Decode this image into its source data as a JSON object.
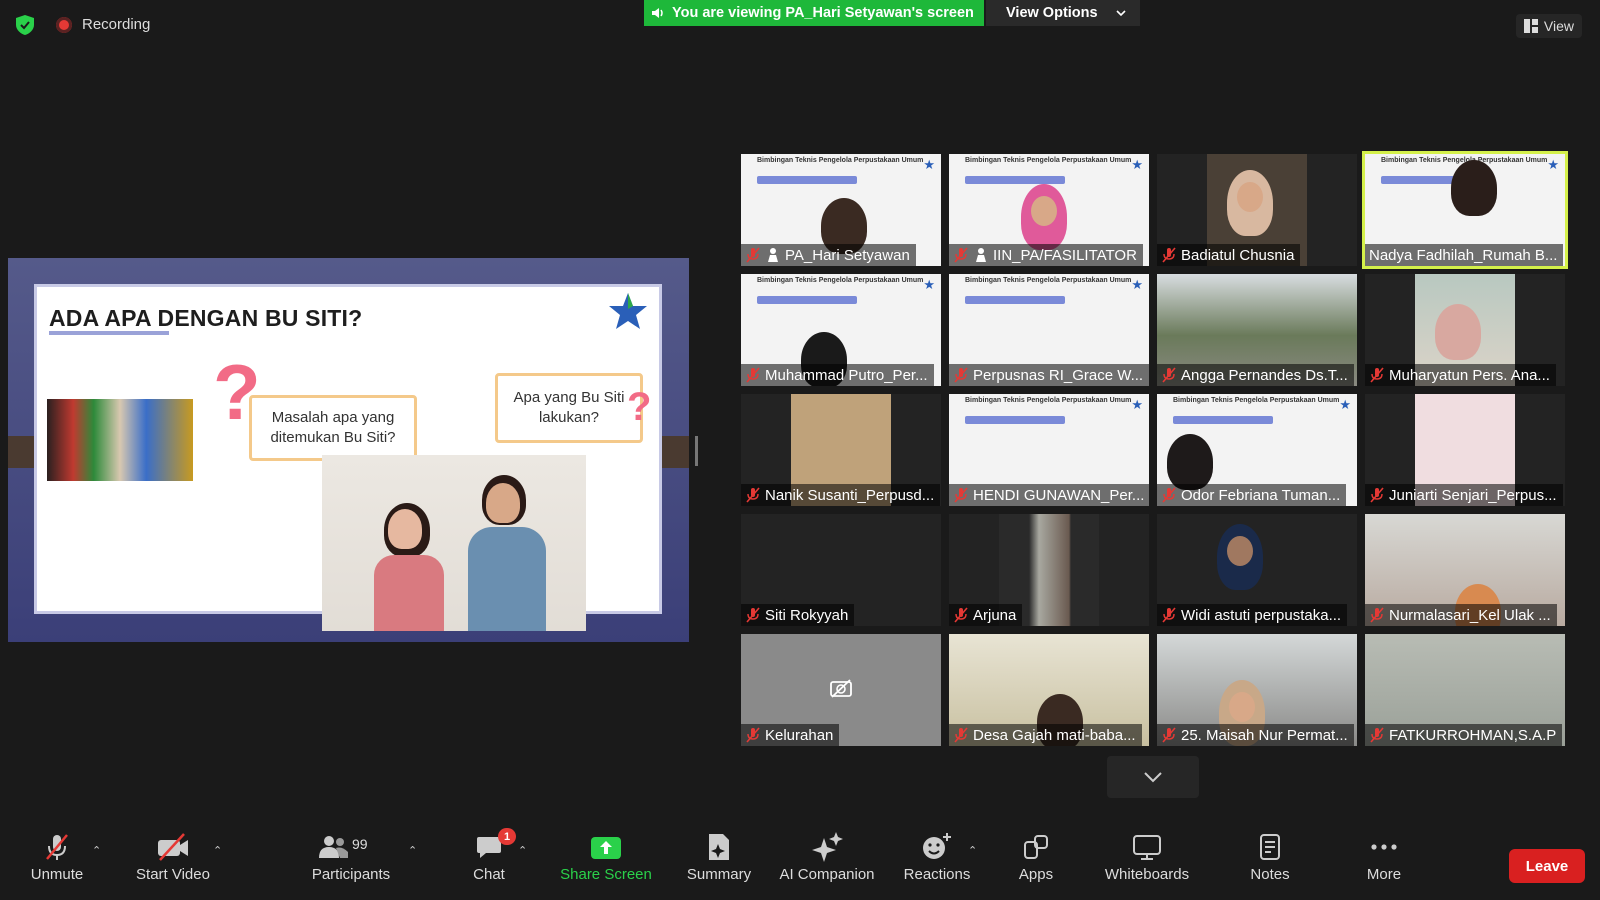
{
  "topbar": {
    "recording_label": "Recording",
    "viewing_banner": "You are viewing PA_Hari Setyawan's screen",
    "view_options_label": "View Options",
    "view_label": "View"
  },
  "shared_slide": {
    "title": "ADA APA DENGAN BU SITI?",
    "bubble_left": "Masalah apa yang ditemukan Bu Siti?",
    "bubble_right": "Apa yang Bu Siti lakukan?"
  },
  "gallery": {
    "participants": [
      {
        "name": "PA_Hari Setyawan",
        "muted": true,
        "host": true
      },
      {
        "name": "IIN_PA/FASILITATOR",
        "muted": true,
        "host": true
      },
      {
        "name": "Badiatul Chusnia",
        "muted": true
      },
      {
        "name": "Nadya Fadhilah_Rumah B...",
        "muted": false,
        "active_speaker": true
      },
      {
        "name": "Muhammad Putro_Per...",
        "muted": true
      },
      {
        "name": "Perpusnas RI_Grace W...",
        "muted": true
      },
      {
        "name": "Angga Pernandes Ds.T...",
        "muted": true
      },
      {
        "name": "Muharyatun Pers. Ana...",
        "muted": true
      },
      {
        "name": "Nanik Susanti_Perpusd...",
        "muted": true
      },
      {
        "name": "HENDI GUNAWAN_Per...",
        "muted": true
      },
      {
        "name": "Odor Febriana Tuman...",
        "muted": true
      },
      {
        "name": "Juniarti Senjari_Perpus...",
        "muted": true
      },
      {
        "name": "Siti Rokyyah",
        "muted": true
      },
      {
        "name": "Arjuna",
        "muted": true
      },
      {
        "name": "Widi astuti perpustaka...",
        "muted": true
      },
      {
        "name": "Nurmalasari_Kel Ulak ...",
        "muted": true
      },
      {
        "name": "Kelurahan",
        "muted": true
      },
      {
        "name": "Desa Gajah mati-baba...",
        "muted": true
      },
      {
        "name": "25. Maisah Nur Permat...",
        "muted": true
      },
      {
        "name": "FATKURROHMAN,S.A.P",
        "muted": true
      }
    ],
    "slide_thumb_title": "Bimbingan Teknis Pengelola Perpustakaan Umum"
  },
  "toolbar": {
    "unmute": "Unmute",
    "start_video": "Start Video",
    "participants": "Participants",
    "participants_count": "99",
    "chat": "Chat",
    "chat_badge": "1",
    "share_screen": "Share Screen",
    "summary": "Summary",
    "ai_companion": "AI Companion",
    "reactions": "Reactions",
    "apps": "Apps",
    "whiteboards": "Whiteboards",
    "notes": "Notes",
    "more": "More",
    "leave": "Leave"
  },
  "colors": {
    "accent_green": "#1eb83a",
    "leave_red": "#d92020",
    "active_speaker": "#d4f04a"
  }
}
